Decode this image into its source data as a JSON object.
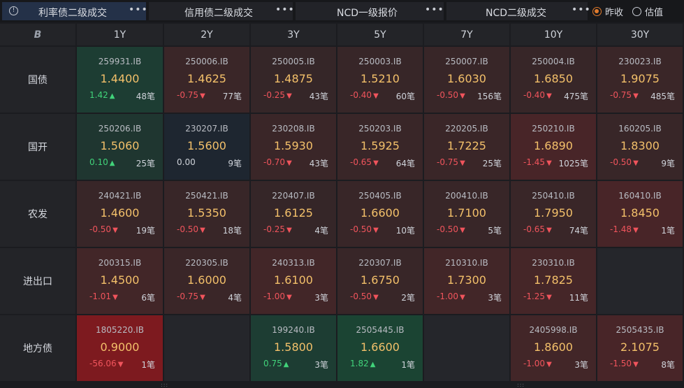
{
  "tabs": [
    {
      "label": "利率债二级成交",
      "more": "•••",
      "active": true,
      "has_info_icon": true
    },
    {
      "label": "信用债二级成交",
      "more": "•••",
      "active": false
    },
    {
      "label": "NCD一级报价",
      "more": "•••",
      "active": false
    },
    {
      "label": "NCD二级成交",
      "more": "•••",
      "active": false
    }
  ],
  "radio_options": [
    {
      "label": "昨收",
      "selected": true
    },
    {
      "label": "估值",
      "selected": false
    }
  ],
  "table": {
    "corner_icon": "B",
    "tenors": [
      "1Y",
      "2Y",
      "3Y",
      "5Y",
      "7Y",
      "10Y",
      "30Y"
    ],
    "rows": [
      {
        "label": "国债",
        "cells": [
          {
            "code": "259931.IB",
            "yield": "1.4400",
            "change": "1.42",
            "direction": "up",
            "count": "48笔",
            "bg": "#1d3d33"
          },
          {
            "code": "250006.IB",
            "yield": "1.4625",
            "change": "-0.75",
            "direction": "down",
            "count": "77笔",
            "bg": "#3a2628"
          },
          {
            "code": "250005.IB",
            "yield": "1.4875",
            "change": "-0.25",
            "direction": "down",
            "count": "43笔",
            "bg": "#352628"
          },
          {
            "code": "250003.IB",
            "yield": "1.5210",
            "change": "-0.40",
            "direction": "down",
            "count": "60笔",
            "bg": "#372628"
          },
          {
            "code": "250007.IB",
            "yield": "1.6030",
            "change": "-0.50",
            "direction": "down",
            "count": "156笔",
            "bg": "#382628"
          },
          {
            "code": "250004.IB",
            "yield": "1.6850",
            "change": "-0.40",
            "direction": "down",
            "count": "475笔",
            "bg": "#372628"
          },
          {
            "code": "230023.IB",
            "yield": "1.9075",
            "change": "-0.75",
            "direction": "down",
            "count": "485笔",
            "bg": "#3a2628"
          }
        ]
      },
      {
        "label": "国开",
        "cells": [
          {
            "code": "250206.IB",
            "yield": "1.5060",
            "change": "0.10",
            "direction": "up",
            "count": "25笔",
            "bg": "#1f3630"
          },
          {
            "code": "230207.IB",
            "yield": "1.5600",
            "change": "0.00",
            "direction": "none",
            "count": "9笔",
            "bg": "#1e2630"
          },
          {
            "code": "230208.IB",
            "yield": "1.5930",
            "change": "-0.70",
            "direction": "down",
            "count": "43笔",
            "bg": "#3a2628"
          },
          {
            "code": "250203.IB",
            "yield": "1.5925",
            "change": "-0.65",
            "direction": "down",
            "count": "64笔",
            "bg": "#392628"
          },
          {
            "code": "220205.IB",
            "yield": "1.7225",
            "change": "-0.75",
            "direction": "down",
            "count": "25笔",
            "bg": "#3a2628"
          },
          {
            "code": "250210.IB",
            "yield": "1.6890",
            "change": "-1.45",
            "direction": "down",
            "count": "1025笔",
            "bg": "#482528"
          },
          {
            "code": "160205.IB",
            "yield": "1.8300",
            "change": "-0.50",
            "direction": "down",
            "count": "9笔",
            "bg": "#382628"
          }
        ]
      },
      {
        "label": "农发",
        "cells": [
          {
            "code": "240421.IB",
            "yield": "1.4600",
            "change": "-0.50",
            "direction": "down",
            "count": "19笔",
            "bg": "#382628"
          },
          {
            "code": "250421.IB",
            "yield": "1.5350",
            "change": "-0.50",
            "direction": "down",
            "count": "18笔",
            "bg": "#382628"
          },
          {
            "code": "220407.IB",
            "yield": "1.6125",
            "change": "-0.25",
            "direction": "down",
            "count": "4笔",
            "bg": "#352628"
          },
          {
            "code": "250405.IB",
            "yield": "1.6600",
            "change": "-0.50",
            "direction": "down",
            "count": "10笔",
            "bg": "#382628"
          },
          {
            "code": "200410.IB",
            "yield": "1.7100",
            "change": "-0.50",
            "direction": "down",
            "count": "5笔",
            "bg": "#382628"
          },
          {
            "code": "250410.IB",
            "yield": "1.7950",
            "change": "-0.65",
            "direction": "down",
            "count": "74笔",
            "bg": "#392628"
          },
          {
            "code": "160410.IB",
            "yield": "1.8450",
            "change": "-1.48",
            "direction": "down",
            "count": "1笔",
            "bg": "#482528"
          }
        ]
      },
      {
        "label": "进出口",
        "cells": [
          {
            "code": "200315.IB",
            "yield": "1.4500",
            "change": "-1.01",
            "direction": "down",
            "count": "6笔",
            "bg": "#422628"
          },
          {
            "code": "220305.IB",
            "yield": "1.6000",
            "change": "-0.75",
            "direction": "down",
            "count": "4笔",
            "bg": "#3a2628"
          },
          {
            "code": "240313.IB",
            "yield": "1.6100",
            "change": "-1.00",
            "direction": "down",
            "count": "3笔",
            "bg": "#422628"
          },
          {
            "code": "220307.IB",
            "yield": "1.6750",
            "change": "-0.50",
            "direction": "down",
            "count": "2笔",
            "bg": "#382628"
          },
          {
            "code": "210310.IB",
            "yield": "1.7300",
            "change": "-1.00",
            "direction": "down",
            "count": "3笔",
            "bg": "#422628"
          },
          {
            "code": "230310.IB",
            "yield": "1.7825",
            "change": "-1.25",
            "direction": "down",
            "count": "11笔",
            "bg": "#452628"
          },
          null
        ]
      },
      {
        "label": "地方债",
        "cells": [
          {
            "code": "1805220.IB",
            "yield": "0.9000",
            "change": "-56.06",
            "direction": "down",
            "count": "1笔",
            "bg": "#7d1a1f"
          },
          null,
          {
            "code": "199240.IB",
            "yield": "1.5800",
            "change": "0.75",
            "direction": "up",
            "count": "3笔",
            "bg": "#1d3d33"
          },
          {
            "code": "2505445.IB",
            "yield": "1.6600",
            "change": "1.82",
            "direction": "up",
            "count": "1笔",
            "bg": "#1b4433"
          },
          null,
          {
            "code": "2405998.IB",
            "yield": "1.8600",
            "change": "-1.00",
            "direction": "down",
            "count": "3笔",
            "bg": "#422628"
          },
          {
            "code": "2505435.IB",
            "yield": "2.1075",
            "change": "-1.50",
            "direction": "down",
            "count": "8笔",
            "bg": "#482528"
          }
        ]
      }
    ]
  },
  "colors": {
    "up": "#41d37a",
    "down": "#f0545c",
    "yield": "#f3c06a",
    "empty": "#25262b",
    "accent": "#e07a2c"
  }
}
